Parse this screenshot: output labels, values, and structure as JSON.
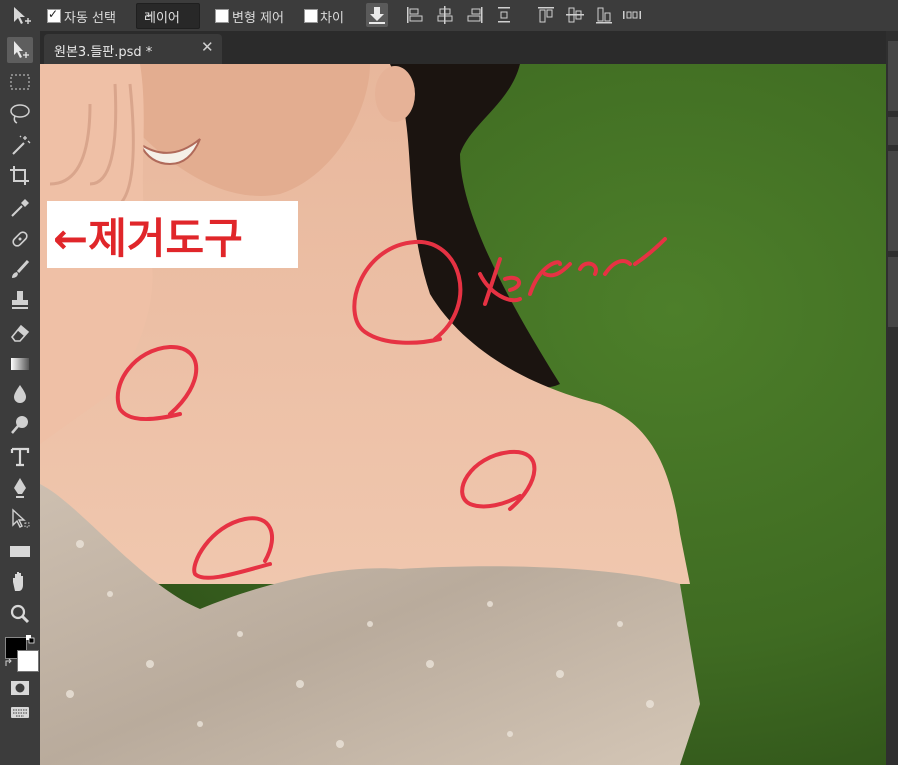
{
  "options_bar": {
    "auto_select_label": "자동 선택",
    "auto_select_checked": true,
    "layer_select_value": "레이어",
    "transform_label": "변형 제어",
    "transform_checked": false,
    "gap_label": "차이",
    "gap_checked": false
  },
  "document_tab": {
    "title": "원본3.들판.psd *",
    "close_icon": "close-icon"
  },
  "toolbar": {
    "tools": [
      "move-tool-icon",
      "marquee-icon",
      "lasso-icon",
      "magic-wand-icon",
      "crop-icon",
      "eyedropper-icon",
      "healing-brush-icon",
      "brush-icon",
      "stamp-icon",
      "eraser-icon",
      "gradient-icon",
      "blur-icon",
      "dodge-icon",
      "type-icon",
      "pen-icon",
      "path-select-icon",
      "rectangle-icon",
      "hand-icon",
      "zoom-icon"
    ],
    "foreground_color": "#000000",
    "background_color": "#ffffff"
  },
  "canvas": {
    "annotation_label": "←제거도구",
    "annotation_color": "#e0262a",
    "handwritten_note": "Before"
  },
  "colors": {
    "ui_dark": "#3c3c3c",
    "tab_bar": "#2b2b2b",
    "annotation_red": "#e63243"
  }
}
